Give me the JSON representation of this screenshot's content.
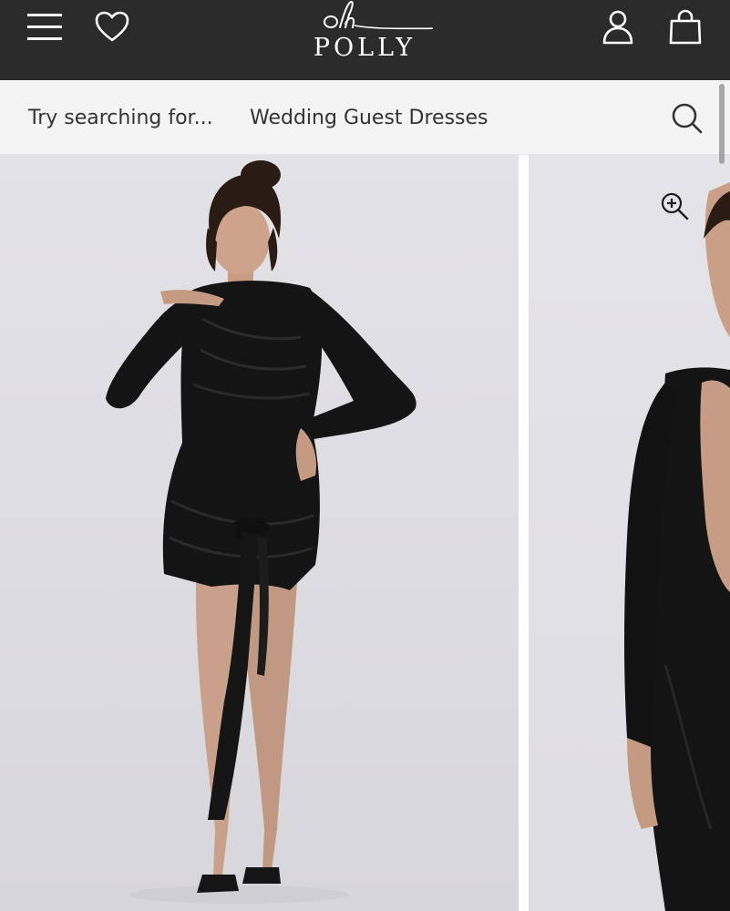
{
  "header": {
    "brand_script": "oh",
    "brand_word": "POLLY",
    "icons": {
      "menu": "hamburger-menu-icon",
      "wishlist": "heart-icon",
      "account": "user-account-icon",
      "bag": "shopping-bag-icon"
    },
    "colors": {
      "background": "#2b2b2b",
      "foreground": "#ffffff"
    }
  },
  "search": {
    "prefix": "Try searching for...",
    "suggestion": "Wedding Guest Dresses",
    "icon": "search-icon",
    "background": "#f4f4f4"
  },
  "gallery": {
    "zoom_icon": "zoom-in-icon",
    "images": [
      {
        "depicts": "model in black long-sleeve mini dress with tie drape, full length"
      },
      {
        "depicts": "close-up side view of black long-sleeve dress"
      }
    ]
  }
}
